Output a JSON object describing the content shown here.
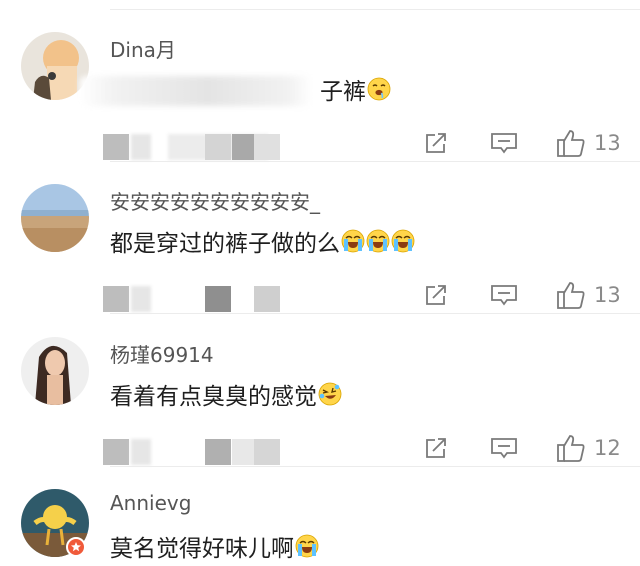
{
  "comments": [
    {
      "username": "Dina月",
      "text": "子裤",
      "like_count": "13",
      "timestamp": "",
      "emojis": [
        "drool-emoji"
      ]
    },
    {
      "username": "安安安安安安安安安安_",
      "text": "都是穿过的裤子做的么",
      "like_count": "13",
      "emojis": [
        "crying-emoji",
        "crying-emoji",
        "crying-emoji"
      ]
    },
    {
      "username": "杨瑾69914",
      "text": "看着有点臭臭的感觉",
      "like_count": "12",
      "emojis": [
        "laugh-cry-emoji"
      ]
    },
    {
      "username": "Annievg",
      "text": "莫名觉得好味儿啊",
      "like_count": "",
      "emojis": [
        "crying-emoji"
      ]
    }
  ],
  "icons": {
    "repost": "repost-icon",
    "comment": "comment-icon",
    "like": "thumbs-up-icon"
  },
  "colors": {
    "username": "#555555",
    "text": "#1f1f1f",
    "meta": "#8a8a8a",
    "divider": "#ececec"
  }
}
